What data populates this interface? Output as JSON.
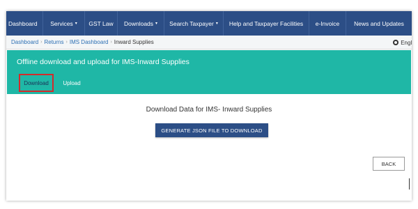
{
  "navbar": {
    "items": [
      {
        "label": "Dashboard",
        "dropdown": false
      },
      {
        "label": "Services",
        "dropdown": true
      },
      {
        "label": "GST Law",
        "dropdown": false
      },
      {
        "label": "Downloads",
        "dropdown": true
      },
      {
        "label": "Search Taxpayer",
        "dropdown": true
      },
      {
        "label": "Help and Taxpayer Facilities",
        "dropdown": false
      },
      {
        "label": "e-Invoice",
        "dropdown": false
      },
      {
        "label": "News and Updates",
        "dropdown": false
      }
    ],
    "caret": "▾"
  },
  "breadcrumb": {
    "items": [
      "Dashboard",
      "Returns",
      "IMS Dashboard"
    ],
    "separator": "›",
    "current": "Inward Supplies",
    "language": "Englis"
  },
  "panel": {
    "title": "Offline download and upload for IMS-Inward Supplies",
    "tabs": {
      "download": "Download",
      "upload": "Upload"
    }
  },
  "main": {
    "heading": "Download Data for IMS- Inward Supplies",
    "generate_button": "GENERATE JSON FILE TO DOWNLOAD",
    "back_button": "BACK"
  },
  "colors": {
    "navbar": "#2c4e86",
    "panel": "#1fb7a6",
    "highlight": "#d52a2a"
  }
}
